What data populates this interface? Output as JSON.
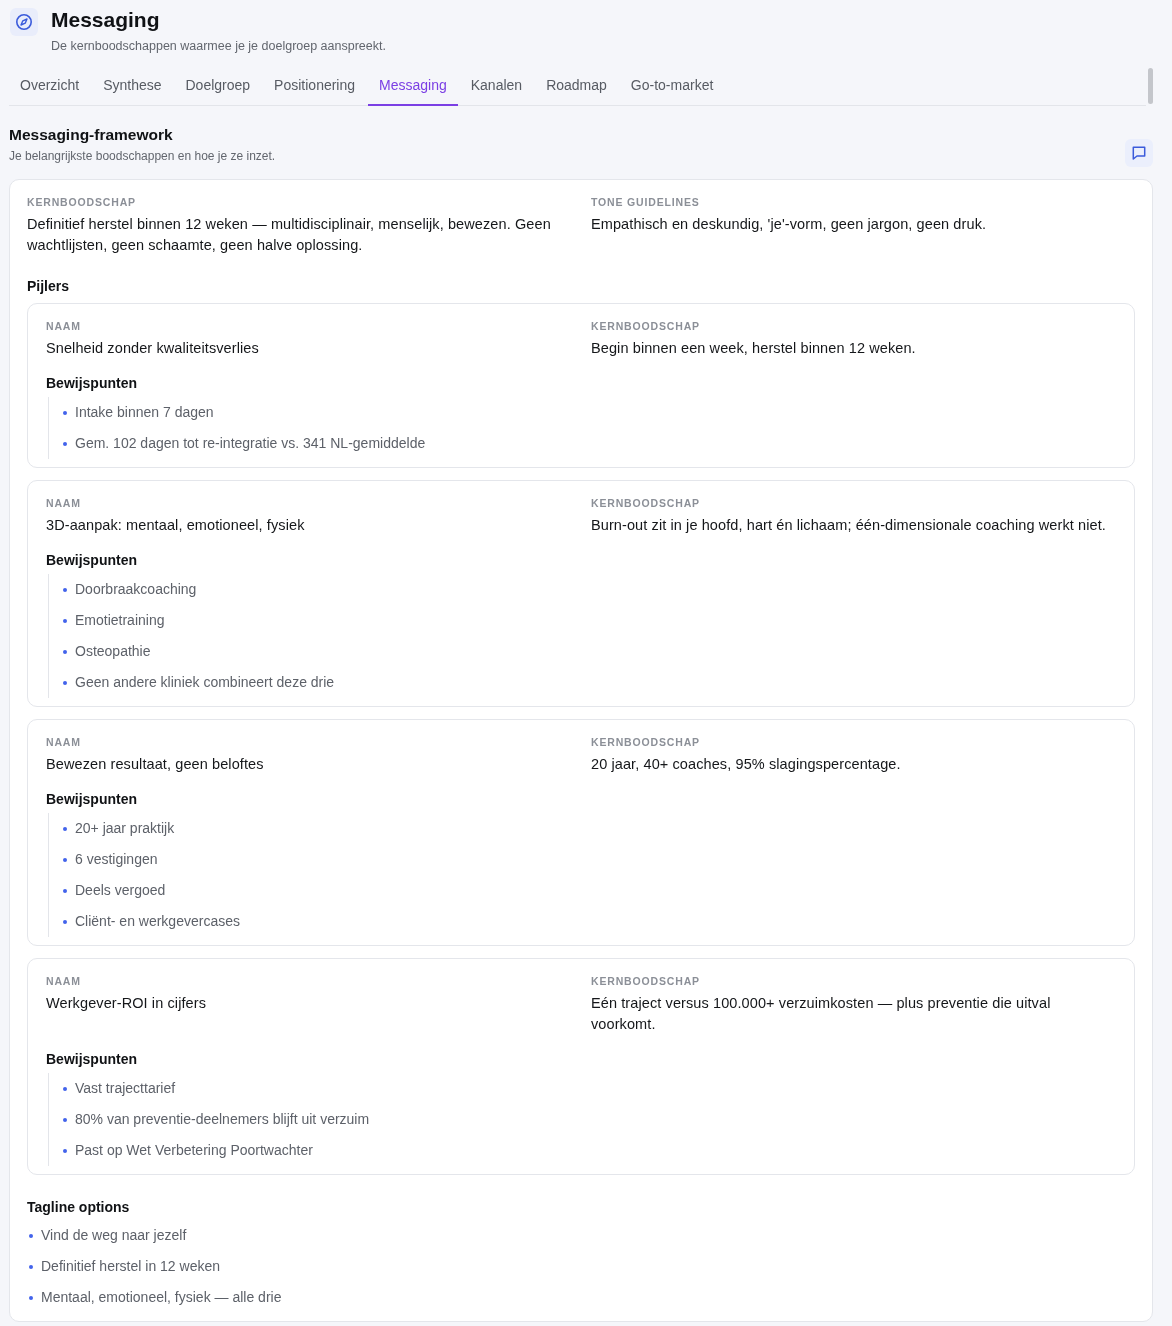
{
  "header": {
    "title": "Messaging",
    "subtitle": "De kernboodschappen waarmee je je doelgroep aanspreekt."
  },
  "tabs": [
    {
      "label": "Overzicht",
      "selected": false
    },
    {
      "label": "Synthese",
      "selected": false
    },
    {
      "label": "Doelgroep",
      "selected": false
    },
    {
      "label": "Positionering",
      "selected": false
    },
    {
      "label": "Messaging",
      "selected": true
    },
    {
      "label": "Kanalen",
      "selected": false
    },
    {
      "label": "Roadmap",
      "selected": false
    },
    {
      "label": "Go-to-market",
      "selected": false
    }
  ],
  "section": {
    "title": "Messaging-framework",
    "subtitle": "Je belangrijkste boodschappen en hoe je ze inzet."
  },
  "framework": {
    "fields": [
      {
        "label": "KERNBOODSCHAP",
        "value": "Definitief herstel binnen 12 weken — multidisciplinair, menselijk, bewezen. Geen wachtlijsten, geen schaamte, geen halve oplossing."
      },
      {
        "label": "TONE GUIDELINES",
        "value": "Empathisch en deskundig, 'je'-vorm, geen jargon, geen druk."
      }
    ],
    "pillars_heading": "Pijlers",
    "pillars": [
      {
        "fields": [
          {
            "label": "NAAM",
            "value": "Snelheid zonder kwaliteitsverlies"
          },
          {
            "label": "KERNBOODSCHAP",
            "value": "Begin binnen een week, herstel binnen 12 weken."
          }
        ],
        "proof_heading": "Bewijspunten",
        "proof_points": [
          "Intake binnen 7 dagen",
          "Gem. 102 dagen tot re-integratie vs. 341 NL-gemiddelde"
        ]
      },
      {
        "fields": [
          {
            "label": "NAAM",
            "value": "3D-aanpak: mentaal, emotioneel, fysiek"
          },
          {
            "label": "KERNBOODSCHAP",
            "value": "Burn-out zit in je hoofd, hart én lichaam; één-dimensionale coaching werkt niet."
          }
        ],
        "proof_heading": "Bewijspunten",
        "proof_points": [
          "Doorbraakcoaching",
          "Emotietraining",
          "Osteopathie",
          "Geen andere kliniek combineert deze drie"
        ]
      },
      {
        "fields": [
          {
            "label": "NAAM",
            "value": "Bewezen resultaat, geen beloftes"
          },
          {
            "label": "KERNBOODSCHAP",
            "value": "20 jaar, 40+ coaches, 95% slagingspercentage."
          }
        ],
        "proof_heading": "Bewijspunten",
        "proof_points": [
          "20+ jaar praktijk",
          "6 vestigingen",
          "Deels vergoed",
          "Cliënt- en werkgevercases"
        ]
      },
      {
        "fields": [
          {
            "label": "NAAM",
            "value": "Werkgever-ROI in cijfers"
          },
          {
            "label": "KERNBOODSCHAP",
            "value": "Eén traject versus 100.000+ verzuimkosten — plus preventie die uitval voorkomt."
          }
        ],
        "proof_heading": "Bewijspunten",
        "proof_points": [
          "Vast trajecttarief",
          "80% van preventie-deelnemers blijft uit verzuim",
          "Past op Wet Verbetering Poortwachter"
        ]
      }
    ],
    "taglines_heading": "Tagline options",
    "taglines": [
      "Vind de weg naar jezelf",
      "Definitief herstel in 12 weken",
      "Mentaal, emotioneel, fysiek — alle drie"
    ]
  }
}
